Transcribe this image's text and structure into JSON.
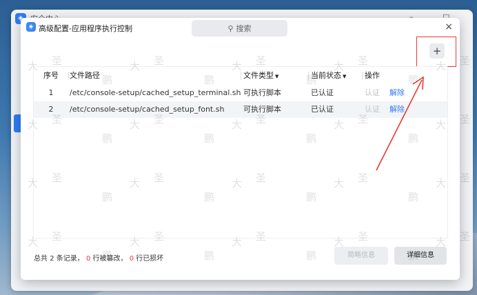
{
  "background_window": {
    "title": "安全中心",
    "controls": {
      "minimize": "–",
      "maximize": "□"
    }
  },
  "dialog": {
    "title": "高级配置-应用程序执行控制",
    "search_placeholder": "搜索",
    "close": "×",
    "add_button": "+",
    "table": {
      "headers": {
        "index": "序号",
        "path": "文件路径",
        "type": "文件类型",
        "status": "当前状态",
        "op": "操作"
      },
      "rows": [
        {
          "index": "1",
          "path": "/etc/console-setup/cached_setup_terminal.sh",
          "type": "可执行脚本",
          "status": "已认证",
          "verify": "认证",
          "remove": "解除"
        },
        {
          "index": "2",
          "path": "/etc/console-setup/cached_setup_font.sh",
          "type": "可执行脚本",
          "status": "已认证",
          "verify": "认证",
          "remove": "解除"
        }
      ]
    },
    "footer": {
      "prefix": "总共",
      "total": "2",
      "records_text": "条记录，",
      "tampered": "0",
      "tampered_text": "行被篡改，",
      "broken": "0",
      "broken_text": "行已损坏"
    },
    "buttons": {
      "summary": "简略信息",
      "detail": "详细信息"
    }
  },
  "watermark": {
    "chars": [
      "鹏",
      "大",
      "圣"
    ]
  },
  "colors": {
    "accent": "#2f7df6",
    "annotation_red": "#e53935"
  }
}
